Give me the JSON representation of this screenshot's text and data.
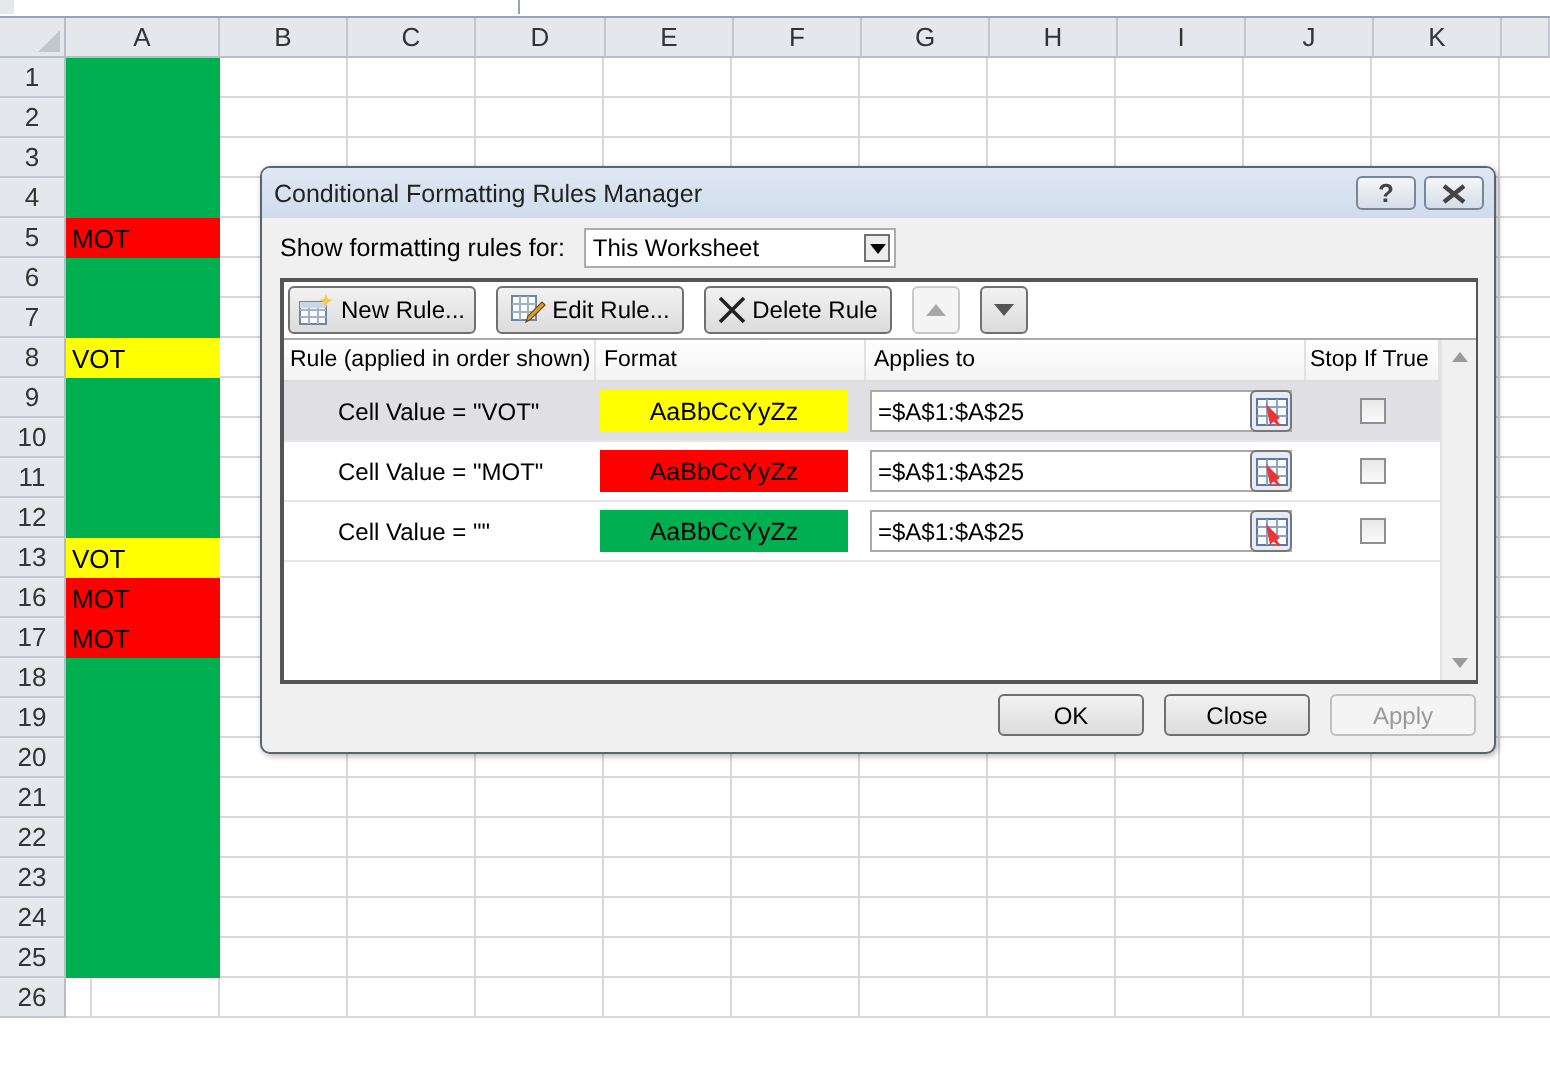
{
  "sheet": {
    "columns": [
      "A",
      "B",
      "C",
      "D",
      "E",
      "F",
      "G",
      "H",
      "I",
      "J",
      "K"
    ],
    "rows": [
      {
        "label": "1",
        "color": "#00b050"
      },
      {
        "label": "2",
        "color": "#00b050"
      },
      {
        "label": "3",
        "color": "#00b050"
      },
      {
        "label": "4",
        "color": "#00b050"
      },
      {
        "label": "5",
        "value": "MOT",
        "color": "#ff0000"
      },
      {
        "label": "6",
        "color": "#00b050"
      },
      {
        "label": "7",
        "color": "#00b050"
      },
      {
        "label": "8",
        "value": "VOT",
        "color": "#ffff00"
      },
      {
        "label": "9",
        "color": "#00b050"
      },
      {
        "label": "10",
        "color": "#00b050"
      },
      {
        "label": "11",
        "color": "#00b050"
      },
      {
        "label": "12",
        "color": "#00b050"
      },
      {
        "label": "13",
        "value": "VOT",
        "color": "#ffff00"
      },
      {
        "label": "16",
        "value": "MOT",
        "color": "#ff0000"
      },
      {
        "label": "17",
        "value": "MOT",
        "color": "#ff0000"
      },
      {
        "label": "18",
        "color": "#00b050"
      },
      {
        "label": "19",
        "color": "#00b050"
      },
      {
        "label": "20",
        "color": "#00b050"
      },
      {
        "label": "21",
        "color": "#00b050"
      },
      {
        "label": "22",
        "color": "#00b050"
      },
      {
        "label": "23",
        "color": "#00b050"
      },
      {
        "label": "24",
        "color": "#00b050"
      },
      {
        "label": "25",
        "color": "#00b050"
      },
      {
        "label": "26"
      }
    ]
  },
  "dialog": {
    "title": "Conditional Formatting Rules Manager",
    "help": "?",
    "show_label": "Show formatting rules for:",
    "show_value": "This Worksheet",
    "toolbar": [
      {
        "kind": "new",
        "label": "New Rule...",
        "disabled": false
      },
      {
        "kind": "edit",
        "label": "Edit Rule...",
        "disabled": false
      },
      {
        "kind": "delete",
        "label": "Delete Rule",
        "disabled": false
      },
      {
        "kind": "up",
        "disabled": true
      },
      {
        "kind": "down",
        "disabled": false
      }
    ],
    "columns": [
      "Rule (applied in order shown)",
      "Format",
      "Applies to",
      "Stop If True"
    ],
    "rules": [
      {
        "rule": "Cell Value = \"VOT\"",
        "format": "AaBbCcYyZz",
        "color": "#ffff00",
        "applies_to": "=$A$1:$A$25",
        "stop_if_true": false,
        "selected": true
      },
      {
        "rule": "Cell Value = \"MOT\"",
        "format": "AaBbCcYyZz",
        "color": "#ff0000",
        "applies_to": "=$A$1:$A$25",
        "stop_if_true": false,
        "selected": false
      },
      {
        "rule": "Cell Value = \"\"",
        "format": "AaBbCcYyZz",
        "color": "#00b050",
        "applies_to": "=$A$1:$A$25",
        "stop_if_true": false,
        "selected": false
      }
    ],
    "buttons": [
      {
        "label": "OK",
        "disabled": false
      },
      {
        "label": "Close",
        "disabled": false
      },
      {
        "label": "Apply",
        "disabled": true
      }
    ]
  }
}
